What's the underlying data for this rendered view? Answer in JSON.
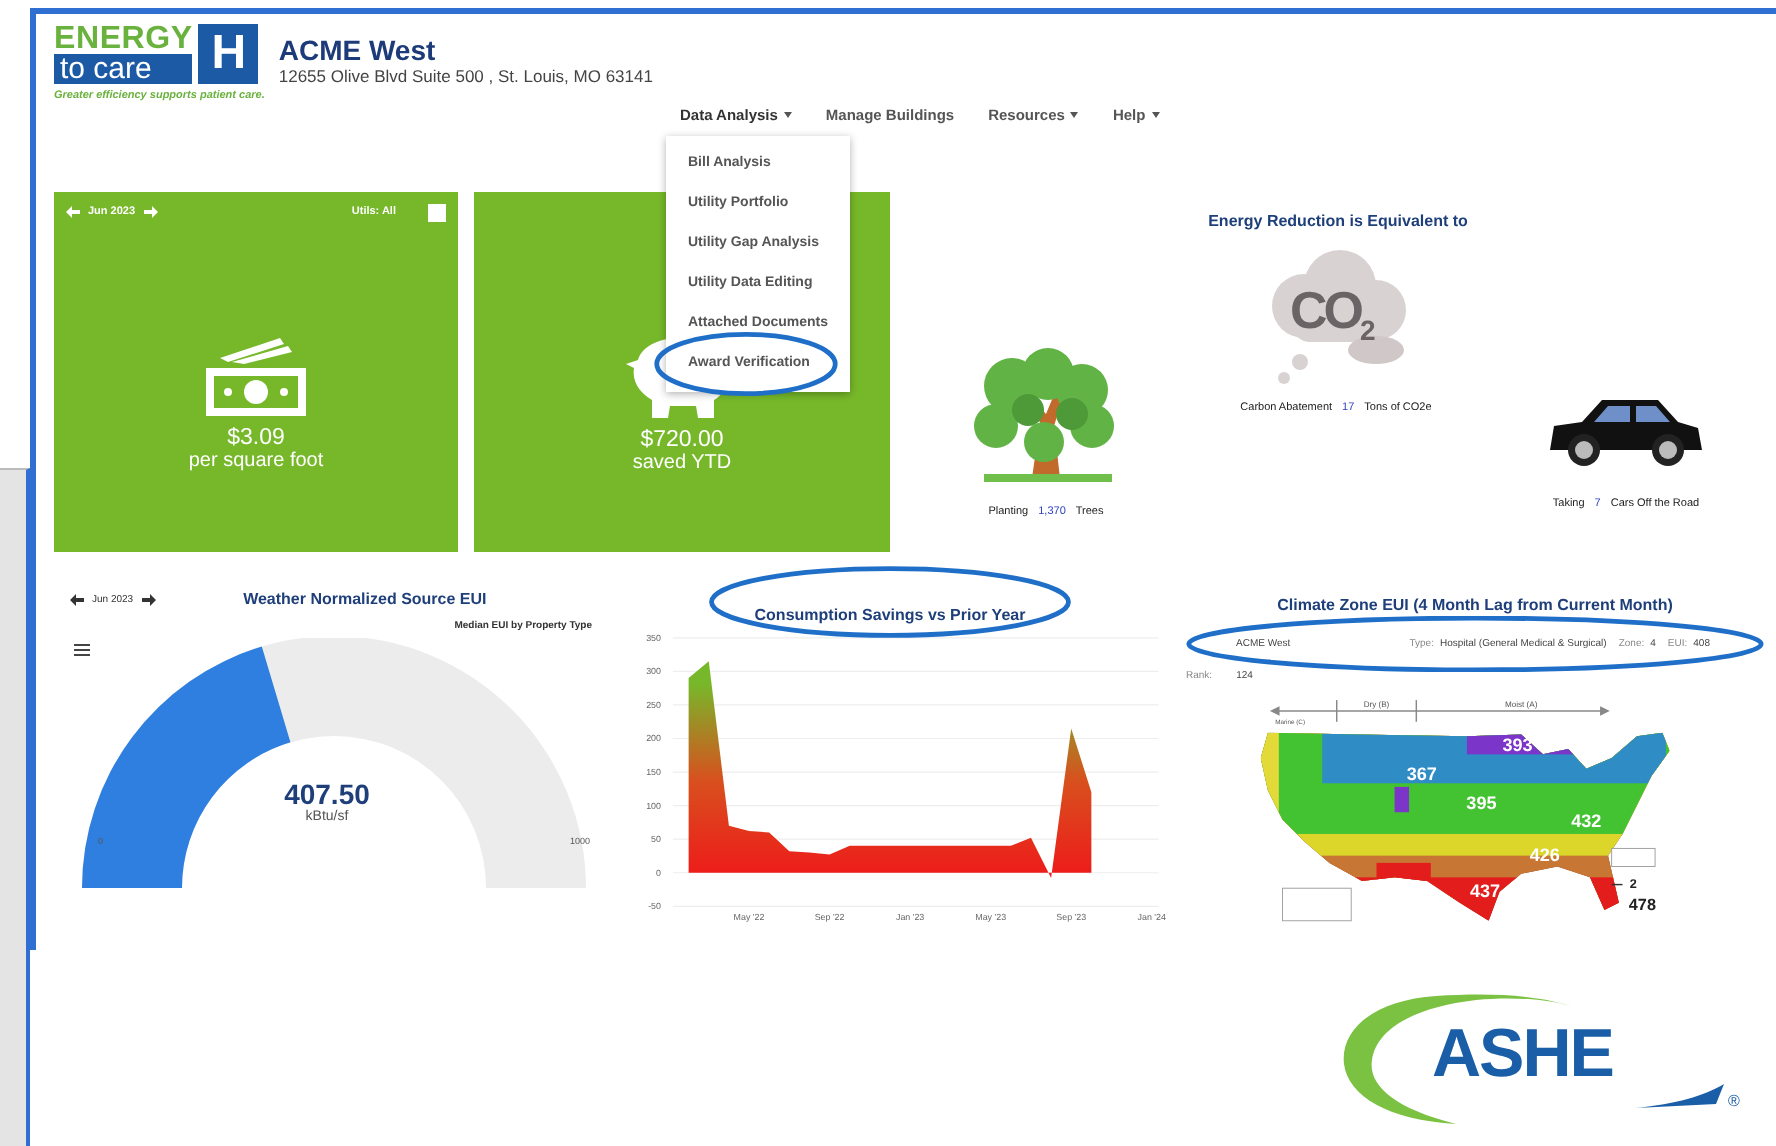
{
  "logo": {
    "line1": "ENERGY",
    "line2": "to care",
    "mark": "H",
    "tagline": "Greater efficiency supports patient care."
  },
  "building": {
    "name": "ACME West",
    "address": "12655 Olive Blvd Suite 500 , St. Louis, MO 63141"
  },
  "nav": [
    {
      "label": "Data Analysis",
      "dropdown": true,
      "expanded": true,
      "menu": [
        {
          "label": "Bill Analysis",
          "annotated": false
        },
        {
          "label": "Utility Portfolio",
          "annotated": false
        },
        {
          "label": "Utility Gap Analysis",
          "annotated": false
        },
        {
          "label": "Utility Data Editing",
          "annotated": false
        },
        {
          "label": "Attached Documents",
          "annotated": false
        },
        {
          "label": "Award Verification",
          "annotated": true
        }
      ]
    },
    {
      "label": "Manage Buildings",
      "dropdown": false,
      "expanded": false
    },
    {
      "label": "Resources",
      "dropdown": true,
      "expanded": false
    },
    {
      "label": "Help",
      "dropdown": true,
      "expanded": false
    }
  ],
  "kpis": [
    {
      "kind": "money",
      "period": "Jun 2023",
      "utils": "Utils: All",
      "value": "$3.09",
      "caption": "per square foot"
    },
    {
      "kind": "piggy",
      "value": "$720.00",
      "caption": "saved YTD"
    }
  ],
  "equivalents": {
    "title": "Energy Reduction is Equivalent to",
    "items": [
      {
        "kind": "tree",
        "prefix": "Planting",
        "value": "1,370",
        "suffix": "Trees"
      },
      {
        "kind": "co2",
        "badge": "CO$_{2}$",
        "prefix": "Carbon Abatement",
        "value": "17",
        "suffix": "Tons of CO2e"
      },
      {
        "kind": "car",
        "prefix": "Taking",
        "value": "7",
        "suffix": "Cars Off the Road"
      }
    ]
  },
  "gauge": {
    "period": "Jun 2023",
    "title": "Weather Normalized Source EUI",
    "subtitle": "Median EUI by Property Type",
    "level": 0.4075,
    "value": "407.50",
    "unit": "kBtu/sf",
    "min": "0",
    "max": "1000"
  },
  "savings": {
    "annotated": true,
    "chart_data": {
      "type": "area",
      "title": "Consumption Savings vs Prior Year",
      "categories": [
        null,
        null,
        null,
        "May '22",
        null,
        null,
        null,
        "Sep '22",
        null,
        null,
        null,
        "Jan '23",
        null,
        null,
        null,
        "May '23",
        null,
        null,
        null,
        "Sep '23",
        null,
        null,
        null,
        "Jan '24"
      ],
      "values": [
        290,
        315,
        70,
        62,
        60,
        32,
        30,
        27,
        40,
        40,
        40,
        40,
        40,
        40,
        40,
        40,
        40,
        52,
        -8,
        215,
        120,
        null,
        null,
        null
      ],
      "grid": true,
      "ylim": [
        -50,
        350
      ],
      "yticks": [
        -50,
        0,
        50,
        100,
        150,
        200,
        250,
        300,
        350
      ]
    }
  },
  "climate": {
    "title": "Climate Zone EUI (4 Month Lag from Current Month)",
    "annotated": true,
    "building": "ACME West",
    "fields": [
      {
        "label": "Type:",
        "value": "Hospital (General Medical & Surgical)"
      },
      {
        "label": "Zone:",
        "value": "4"
      },
      {
        "label": "EUI:",
        "value": "408"
      }
    ],
    "rank": {
      "label": "Rank:",
      "value": "124"
    },
    "axis": [
      "Marine (C)",
      "Dry (B)",
      "Moist (A)"
    ],
    "map_labels": [
      "393",
      "367",
      "395",
      "432",
      "426",
      "437",
      "2",
      "478"
    ]
  },
  "ashe_logo": {
    "text": "ASHE",
    "mark": "®"
  }
}
